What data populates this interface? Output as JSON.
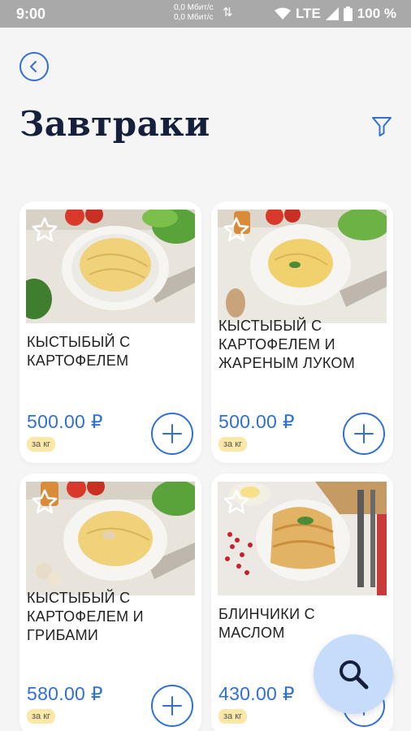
{
  "status_bar": {
    "time": "9:00",
    "net_up": "0,0 Мбит/с",
    "net_down": "0,0 Мбит/с",
    "network": "LTE",
    "battery": "100 %"
  },
  "header": {
    "title": "Завтраки",
    "back_icon": "back-arrow-icon",
    "filter_icon": "filter-icon"
  },
  "products": [
    {
      "name": "КЫСТЫБЫЙ С КАРТОФЕЛЕМ",
      "price": "500.00 ₽",
      "unit": "за кг",
      "favorite": false
    },
    {
      "name": "КЫСТЫБЫЙ С КАРТОФЕЛЕМ И ЖАРЕНЫМ ЛУКОМ",
      "price": "500.00 ₽",
      "unit": "за кг",
      "favorite": false
    },
    {
      "name": "КЫСТЫБЫЙ С КАРТОФЕЛЕМ И ГРИБАМИ",
      "price": "580.00 ₽",
      "unit": "за кг",
      "favorite": false
    },
    {
      "name": "БЛИНЧИКИ С МАСЛОМ",
      "price": "430.00 ₽",
      "unit": "за кг",
      "favorite": false
    }
  ],
  "colors": {
    "accent": "#2f6fd8",
    "title": "#15203c",
    "unit_badge": "#fbe7a6",
    "fab": "#c7dcfb"
  }
}
